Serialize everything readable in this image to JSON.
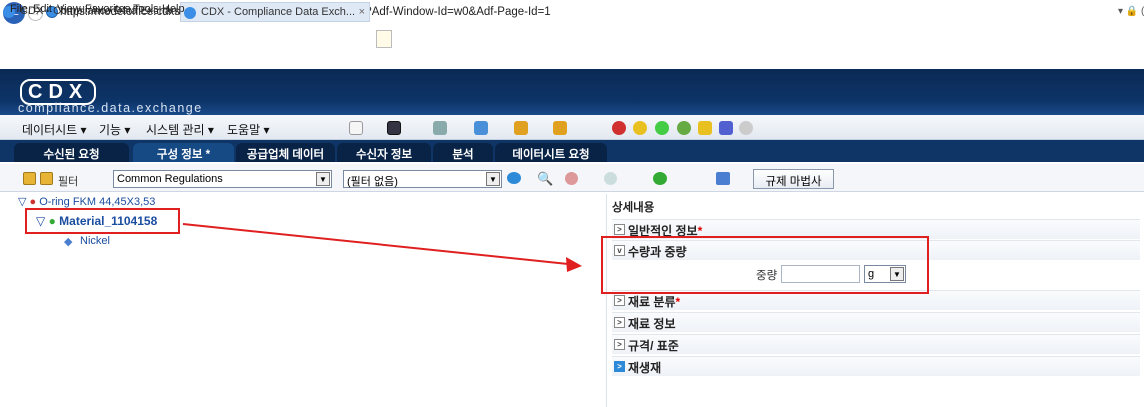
{
  "browser": {
    "url": "https://modeloffice.cdxsystem.com/cdx/faces/requestSearch?Adf-Window-Id=w0&Adf-Page-Id=1",
    "tabs": [
      "CDX - Compliance Data Exchan...",
      "CDX - Compliance Data Exch..."
    ],
    "tab_close": "×",
    "menu": [
      "File",
      "Edit",
      "View",
      "Favorites",
      "Tools",
      "Help"
    ],
    "address_controls": "▾ 🔒 ("
  },
  "app": {
    "logo_text": "CDX",
    "logo_subtitle": "compliance.data.exchange",
    "top_menu": [
      "데이터시트 ▾",
      "기능 ▾",
      "시스템 관리 ▾",
      "도움말 ▾"
    ],
    "nav_tabs": [
      "수신된 요청",
      "구성 정보 *",
      "공급업체 데이터",
      "수신자 정보",
      "분석",
      "데이터시트 요청"
    ],
    "filter_label": "필터",
    "filter_value": "Common Regulations",
    "filter2_value": "(필터 없음)",
    "regulation_wizard_button": "규제 마법사"
  },
  "tree": {
    "root": "O-ring FKM 44,45X3,53",
    "material": "Material_1104158",
    "child": "Nickel"
  },
  "detail": {
    "title": "상세내용",
    "sections": [
      {
        "label": "일반적인 정보",
        "required": true,
        "expanded": false
      },
      {
        "label": "수량과 중량",
        "required": false,
        "expanded": true
      },
      {
        "label": "재료 분류",
        "required": true,
        "expanded": false
      },
      {
        "label": "재료 정보",
        "required": false,
        "expanded": false
      },
      {
        "label": "규격/ 표준",
        "required": false,
        "expanded": false
      },
      {
        "label": "재생재",
        "required": false,
        "expanded": false
      }
    ],
    "weight_label": "중량",
    "weight_value": "",
    "weight_unit": "g"
  },
  "colors": {
    "header": "#0d3468",
    "annotation_red": "#e02020"
  }
}
